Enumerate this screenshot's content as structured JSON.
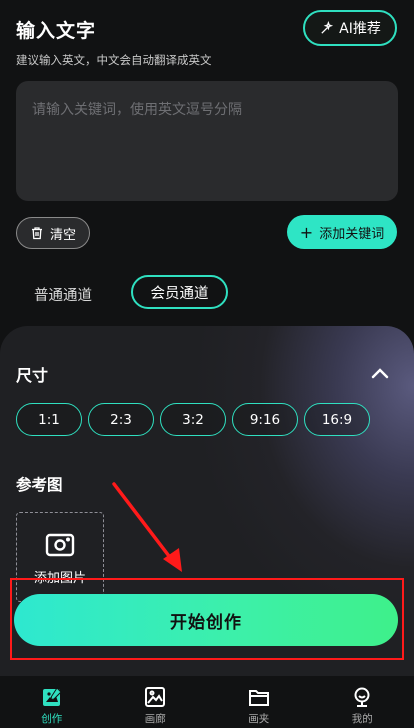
{
  "header": {
    "title": "输入文字",
    "subtitle": "建议输入英文，中文会自动翻译成英文",
    "ai_button_label": "AI推荐"
  },
  "prompt": {
    "placeholder": "请输入关键词，使用英文逗号分隔"
  },
  "actions": {
    "clear_label": "清空",
    "add_keyword_label": "添加关键词",
    "add_keyword_plus": "+"
  },
  "channels": {
    "normal": "普通通道",
    "vip": "会员通道",
    "selected": "会员通道"
  },
  "settings": {
    "size_label": "尺寸",
    "ratios": [
      "1:1",
      "2:3",
      "3:2",
      "9:16",
      "16:9"
    ],
    "reference_label": "参考图",
    "upload_label": "添加图片"
  },
  "start_button_label": "开始创作",
  "tabbar": {
    "items": [
      {
        "label": "创作",
        "icon": "create-icon",
        "active": true
      },
      {
        "label": "画廊",
        "icon": "gallery-icon",
        "active": false
      },
      {
        "label": "画夹",
        "icon": "folder-icon",
        "active": false
      },
      {
        "label": "我的",
        "icon": "profile-icon",
        "active": false
      }
    ]
  },
  "colors": {
    "accent": "#2fe0c0",
    "highlight_border": "#ff1a1a",
    "background": "#111213"
  }
}
